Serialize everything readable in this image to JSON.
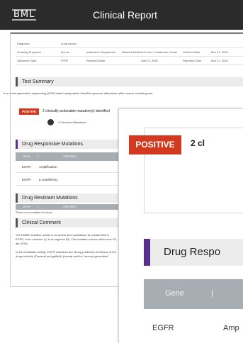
{
  "header": {
    "logo": "BML",
    "title": "Clinical Report"
  },
  "info": {
    "rows": [
      [
        {
          "label": "Diagnosis",
          "value": "Lung cancer"
        }
      ],
      [
        {
          "label": "Ordering Physician",
          "value": "Dr.Lee"
        },
        {
          "label": "Institution / Department",
          "value": "National Medical Center / Healthcare Center"
        },
        {
          "label": "Ordered Date",
          "value": "Mar 21, 2016"
        }
      ],
      [
        {
          "label": "Specimen Type",
          "value": "FFPE"
        },
        {
          "label": "Received Date",
          "value": "Mar 21, 2016"
        },
        {
          "label": "Reported Date",
          "value": "Mar 21, 2016"
        }
      ]
    ]
  },
  "test_summary": {
    "title": "Test Summary",
    "description": "It is a next-generation sequencing (NGS) based assay which identifies genomic alterations within cancer-related genes.",
    "badge": "POSITIVE",
    "result": "2 clinically actionable mutation(s) identified",
    "alterations": "2 Genomic Alterations"
  },
  "drug_responsive": {
    "title": "Drug Responsive Mutations",
    "columns": [
      "Gene",
      "|",
      "Alteration"
    ],
    "rows": [
      {
        "gene": "EGFR",
        "alteration": "Amplification"
      },
      {
        "gene": "EGFR",
        "alteration": "p.Leu858Arg"
      }
    ]
  },
  "drug_resistant": {
    "title": "Drug Resistant Mutations",
    "columns": [
      "Gene",
      "|",
      "Alteration"
    ],
    "note": "There is no mutation to show."
  },
  "clinical_comment": {
    "title": "Clinical Comment",
    "paragraph1": "The L858R mutation results in an amino acid substitution at position 858 in EGFR, from a leucine (L) to an arginine (R). This mutation occurs within exon 21, which encodes part of the kinase domain, and occurs with a frequency of 40%",
    "paragraph1_end": "ate 2016).",
    "paragraph2": "In the metastatic setting, EGFR mutations are strong predictors of efficacy of the first-generation EGFR tyrosine kinase inhibitors (TKIs) such as the",
    "paragraph2_end": "drugs erlotinib (Tarceva) and gefitinib (Iressa) and the \"second-generation\""
  },
  "zoom": {
    "badge": "POSITIVE",
    "result_partial": "2 cl",
    "section_partial": "Drug Respo",
    "col_gene": "Gene",
    "col_sep": "|",
    "row_gene": "EGFR",
    "row_alt_partial": "Amp"
  },
  "colors": {
    "header_bg": "#2b2b2b",
    "positive": "#d2391f",
    "accent_purple": "#5b2d8e",
    "table_header": "#a6adb3"
  }
}
